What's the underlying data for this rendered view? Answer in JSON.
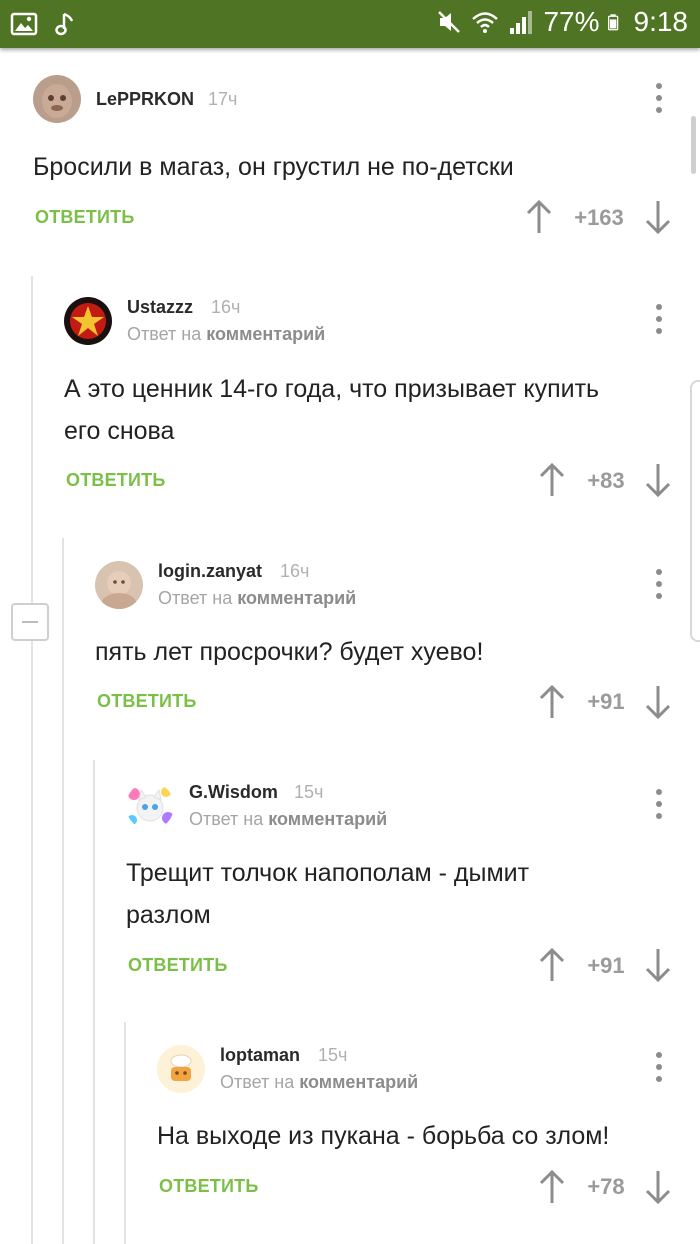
{
  "status_bar": {
    "battery": "77%",
    "time": "9:18",
    "icons": [
      "image-icon",
      "music-note-icon",
      "mute-icon",
      "wifi-icon",
      "signal-icon",
      "battery-icon"
    ]
  },
  "comments": [
    {
      "author": "LePPRKON",
      "time": "17ч",
      "reply_to_prefix": "",
      "reply_to_target": "",
      "text_lines": [
        "Бросили в магаз, он грустил не по-детски"
      ],
      "reply_label": "ОТВЕТИТЬ",
      "score": "+163"
    },
    {
      "author": "Ustazzz",
      "time": "16ч",
      "reply_to_prefix": "Ответ на",
      "reply_to_target": "комментарий",
      "text_lines": [
        "А это ценник 14-го года, что призывает купить",
        "его снова"
      ],
      "reply_label": "ОТВЕТИТЬ",
      "score": "+83"
    },
    {
      "author": "login.zanyat",
      "time": "16ч",
      "reply_to_prefix": "Ответ на",
      "reply_to_target": "комментарий",
      "text_lines": [
        "пять лет просрочки? будет хуево!"
      ],
      "reply_label": "ОТВЕТИТЬ",
      "score": "+91"
    },
    {
      "author": "G.Wisdom",
      "time": "15ч",
      "reply_to_prefix": "Ответ на",
      "reply_to_target": "комментарий",
      "text_lines": [
        "Трещит толчок напополам - дымит",
        "разлом"
      ],
      "reply_label": "ОТВЕТИТЬ",
      "score": "+91"
    },
    {
      "author": "loptaman",
      "time": "15ч",
      "reply_to_prefix": "Ответ на",
      "reply_to_target": "комментарий",
      "text_lines": [
        "На выходе из пукана - борьба со злом!"
      ],
      "reply_label": "ОТВЕТИТЬ",
      "score": "+78"
    }
  ],
  "colors": {
    "status_bar": "#4f7524",
    "reply": "#7bbf47",
    "score": "#9a9a9a"
  }
}
